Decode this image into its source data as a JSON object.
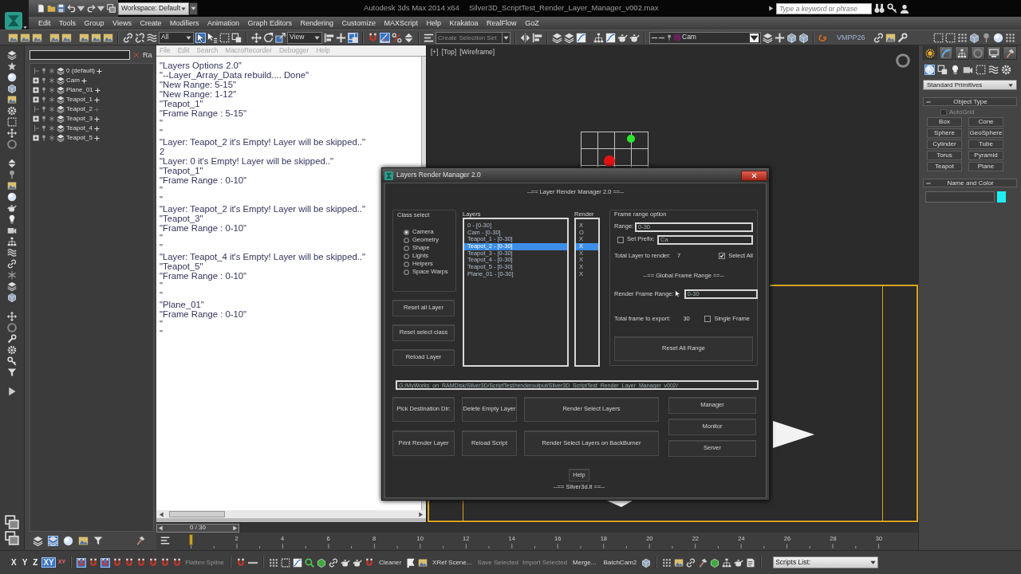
{
  "title_bar": {
    "workspace": "Workspace: Default",
    "app_title": "Autodesk 3ds Max 2014 x64",
    "file_title": "Silver3D_ScriptTest_Render_Layer_Manager_v002.max",
    "search": {
      "placeholder": "Type a keyword or phrase"
    }
  },
  "menu_bar": [
    "Edit",
    "Tools",
    "Group",
    "Views",
    "Create",
    "Modifiers",
    "Animation",
    "Graph Editors",
    "Rendering",
    "Customize",
    "MAXScript",
    "Help",
    "Krakatoa",
    "RealFlow",
    "GoZ"
  ],
  "main_toolbar": {
    "selection_filter": "All",
    "reference_coordinates": "View",
    "selection_set": {
      "placeholder": "Create Selection Set"
    },
    "current_layer": {
      "name": "Cam",
      "color": "#6b1f5e"
    },
    "plugin_label": "VMPP26",
    "active": {
      "select_object": true,
      "manipulate": true,
      "angle_snap": true
    }
  },
  "layer_explorer": {
    "side_label": "Ra",
    "layers": [
      {
        "name": "0 (default)",
        "expandable": false,
        "plus_dimmed": false
      },
      {
        "name": "Cam",
        "expandable": true,
        "plus_dimmed": false
      },
      {
        "name": "Plane_01",
        "expandable": true,
        "plus_dimmed": false
      },
      {
        "name": "Teapot_1",
        "expandable": true,
        "plus_dimmed": false
      },
      {
        "name": "Teapot_2",
        "expandable": false,
        "plus_dimmed": true
      },
      {
        "name": "Teapot_3",
        "expandable": true,
        "plus_dimmed": false
      },
      {
        "name": "Teapot_4",
        "expandable": false,
        "plus_dimmed": false
      },
      {
        "name": "Teapot_5",
        "expandable": true,
        "plus_dimmed": false
      }
    ],
    "display_modes": [
      {
        "selected": false
      },
      {
        "selected": true
      },
      {
        "selected": false
      }
    ]
  },
  "listener": {
    "menu": [
      "File",
      "Edit",
      "Search",
      "MacroRecorder",
      "Debugger",
      "Help"
    ],
    "lines": [
      "\"Layers Options 2.0\"",
      "\"--Layer_Array_Data rebuild.... Done\"",
      "\"New Range: 5-15\"",
      "\"New Range: 1-12\"",
      "\"Teapot_1\"",
      "\"Frame Range : 5-15\"",
      "\"",
      "\"",
      "\"Layer: Teapot_2 it's Empty! Layer will be skipped..\"",
      "2",
      "\"Layer: 0 it's Empty! Layer will be skipped..\"",
      "\"Teapot_1\"",
      "\"Frame Range : 0-10\"",
      "\"",
      "\"",
      "\"Layer: Teapot_2 it's Empty! Layer will be skipped..\"",
      "\"Teapot_3\"",
      "\"Frame Range : 0-10\"",
      "\"",
      "\"",
      "\"Layer: Teapot_4 it's Empty! Layer will be skipped..\"",
      "\"Teapot_5\"",
      "\"Frame Range : 0-10\"",
      "\"",
      "\"",
      "\"Plane_01\"",
      "\"Frame Range : 0-10\"",
      "\"",
      "\""
    ]
  },
  "viewport": {
    "labels": [
      "[+]",
      "[Top]",
      "[Wireframe]"
    ]
  },
  "command_panel": {
    "tabs": [
      {
        "selected": true
      },
      {
        "selected": false
      },
      {
        "selected": false
      },
      {
        "selected": false
      },
      {
        "selected": false
      },
      {
        "selected": false
      }
    ],
    "categories": [
      {
        "selected": true
      },
      {
        "selected": false
      },
      {
        "selected": false
      },
      {
        "selected": false
      },
      {
        "selected": false
      },
      {
        "selected": false
      },
      {
        "selected": false
      }
    ],
    "category_dropdown": "Standard Primitives",
    "object_type": {
      "title": "Object Type",
      "expanded": true,
      "autogrid": {
        "label": "AutoGrid",
        "checked": false,
        "disabled": true
      },
      "buttons": [
        "Box",
        "Cone",
        "Sphere",
        "GeoSphere",
        "Cylinder",
        "Tube",
        "Torus",
        "Pyramid",
        "Teapot",
        "Plane"
      ]
    },
    "name_and_color": {
      "title": "Name and Color",
      "expanded": true,
      "color": "#1ef0f0"
    }
  },
  "dialog": {
    "title": "Layers Render Manager 2.0",
    "heading": "--== Layer Render Manager 2.0 ==--",
    "class_select": {
      "label": "Class select",
      "options": [
        {
          "label": "Camera",
          "selected": true
        },
        {
          "label": "Geometry",
          "selected": false
        },
        {
          "label": "Shape",
          "selected": false
        },
        {
          "label": "Lights",
          "selected": false
        },
        {
          "label": "Helpers",
          "selected": false
        },
        {
          "label": "Space Warps",
          "selected": false
        }
      ]
    },
    "left_buttons": [
      "Reset all Layer",
      "Reset select class",
      "Reload Layer"
    ],
    "layers": {
      "label": "Layers",
      "items": [
        {
          "label": "0 - [0-30]",
          "selected": false
        },
        {
          "label": "Cam - [0-30]",
          "selected": false
        },
        {
          "label": "Teapot_1 - [0-30]",
          "selected": false
        },
        {
          "label": "Teapot_2 - [0-30]",
          "selected": true
        },
        {
          "label": "Teapot_3 - [0-30]",
          "selected": false
        },
        {
          "label": "Teapot_4 - [0-30]",
          "selected": false
        },
        {
          "label": "Teapot_5 - [0-30]",
          "selected": false
        },
        {
          "label": "Plane_01 - [0-30]",
          "selected": false
        }
      ]
    },
    "render": {
      "label": "Render",
      "items": [
        {
          "label": "X",
          "selected": false
        },
        {
          "label": "O",
          "selected": false
        },
        {
          "label": "X",
          "selected": false
        },
        {
          "label": "X",
          "selected": true
        },
        {
          "label": "X",
          "selected": false
        },
        {
          "label": "X",
          "selected": false
        },
        {
          "label": "X",
          "selected": false
        },
        {
          "label": "X",
          "selected": false
        }
      ]
    },
    "frame_range": {
      "label": "Frame range option",
      "range": {
        "label": "Range:",
        "value": "0-30"
      },
      "prefix": {
        "label": "Set Prefix:",
        "checked": false,
        "value": "Ca"
      },
      "total_layers": {
        "label": "Total Layer to render:",
        "value": "7"
      },
      "select_all": {
        "label": "Select All",
        "checked": true
      },
      "global_heading": "--== Global Frame Range ==--",
      "render_range": {
        "label": "Render Frame Range:",
        "value": "0-30"
      },
      "total_frames": {
        "label": "Total frame to export:",
        "value": "30"
      },
      "single_frame": {
        "label": "Single Frame",
        "checked": false
      },
      "reset_button": "Reset All Range"
    },
    "path": {
      "value": "G:/MyWorks_on_RAMDisk/Silver3D/ScriptTest/renderoutput/Silver3D_ScriptTest_Render_Layer_Manager_v002/"
    },
    "action_buttons": [
      "Pick Destination Dir:",
      "Delete Empty Layer",
      "Render Select Layers",
      "Print Render Layer",
      "Reload Script",
      "Render Select Layers on BackBurner"
    ],
    "server_buttons": [
      "Manager",
      "Monitor",
      "Server"
    ],
    "help_button": "Help",
    "footer": "--== Silver3d.it ==--"
  },
  "timeline": {
    "time_slider": {
      "label": "0 / 30",
      "level": 0
    },
    "ticks": [
      "2",
      "4",
      "6",
      "8",
      "10",
      "12",
      "14",
      "16",
      "18",
      "20",
      "22",
      "24",
      "26",
      "28",
      "30"
    ]
  },
  "status_bar": {
    "axes": [
      {
        "label": "X",
        "selected": false
      },
      {
        "label": "Y",
        "selected": false
      },
      {
        "label": "Z",
        "selected": false
      },
      {
        "label": "XY",
        "selected": true
      }
    ],
    "axis_toggle": "XY",
    "snap_toggles": [
      {
        "on": true
      },
      {
        "on": false
      },
      {
        "on": true
      },
      {
        "on": false
      },
      {
        "on": false
      },
      {
        "on": false
      },
      {
        "on": false
      }
    ],
    "tools": [
      {
        "label": "Flatten Spline",
        "disabled": true
      },
      {
        "label": "Cleaner",
        "disabled": false
      },
      {
        "label": "XRef Scene...",
        "disabled": false
      },
      {
        "label": "Save Selected",
        "disabled": true
      },
      {
        "label": "Import Selected",
        "disabled": true
      },
      {
        "label": "Merge...",
        "disabled": false
      },
      {
        "label": "BatchCam2",
        "disabled": false
      }
    ],
    "scripts_list": "Scripts List:"
  }
}
